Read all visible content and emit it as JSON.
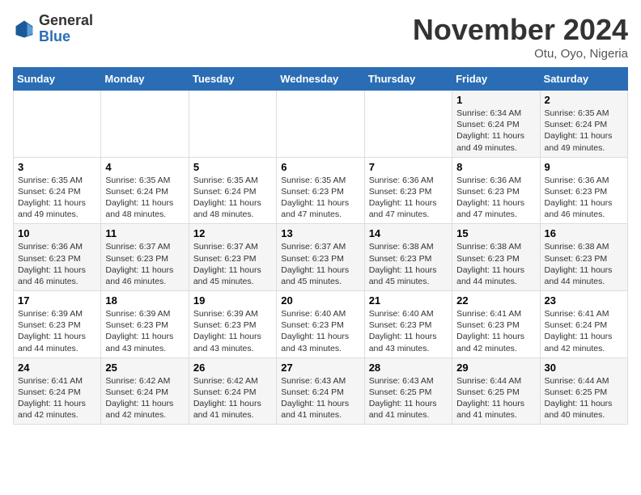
{
  "logo": {
    "general": "General",
    "blue": "Blue"
  },
  "header": {
    "month_title": "November 2024",
    "location": "Otu, Oyo, Nigeria"
  },
  "weekdays": [
    "Sunday",
    "Monday",
    "Tuesday",
    "Wednesday",
    "Thursday",
    "Friday",
    "Saturday"
  ],
  "weeks": [
    [
      {
        "day": "",
        "info": ""
      },
      {
        "day": "",
        "info": ""
      },
      {
        "day": "",
        "info": ""
      },
      {
        "day": "",
        "info": ""
      },
      {
        "day": "",
        "info": ""
      },
      {
        "day": "1",
        "info": "Sunrise: 6:34 AM\nSunset: 6:24 PM\nDaylight: 11 hours and 49 minutes."
      },
      {
        "day": "2",
        "info": "Sunrise: 6:35 AM\nSunset: 6:24 PM\nDaylight: 11 hours and 49 minutes."
      }
    ],
    [
      {
        "day": "3",
        "info": "Sunrise: 6:35 AM\nSunset: 6:24 PM\nDaylight: 11 hours and 49 minutes."
      },
      {
        "day": "4",
        "info": "Sunrise: 6:35 AM\nSunset: 6:24 PM\nDaylight: 11 hours and 48 minutes."
      },
      {
        "day": "5",
        "info": "Sunrise: 6:35 AM\nSunset: 6:24 PM\nDaylight: 11 hours and 48 minutes."
      },
      {
        "day": "6",
        "info": "Sunrise: 6:35 AM\nSunset: 6:23 PM\nDaylight: 11 hours and 47 minutes."
      },
      {
        "day": "7",
        "info": "Sunrise: 6:36 AM\nSunset: 6:23 PM\nDaylight: 11 hours and 47 minutes."
      },
      {
        "day": "8",
        "info": "Sunrise: 6:36 AM\nSunset: 6:23 PM\nDaylight: 11 hours and 47 minutes."
      },
      {
        "day": "9",
        "info": "Sunrise: 6:36 AM\nSunset: 6:23 PM\nDaylight: 11 hours and 46 minutes."
      }
    ],
    [
      {
        "day": "10",
        "info": "Sunrise: 6:36 AM\nSunset: 6:23 PM\nDaylight: 11 hours and 46 minutes."
      },
      {
        "day": "11",
        "info": "Sunrise: 6:37 AM\nSunset: 6:23 PM\nDaylight: 11 hours and 46 minutes."
      },
      {
        "day": "12",
        "info": "Sunrise: 6:37 AM\nSunset: 6:23 PM\nDaylight: 11 hours and 45 minutes."
      },
      {
        "day": "13",
        "info": "Sunrise: 6:37 AM\nSunset: 6:23 PM\nDaylight: 11 hours and 45 minutes."
      },
      {
        "day": "14",
        "info": "Sunrise: 6:38 AM\nSunset: 6:23 PM\nDaylight: 11 hours and 45 minutes."
      },
      {
        "day": "15",
        "info": "Sunrise: 6:38 AM\nSunset: 6:23 PM\nDaylight: 11 hours and 44 minutes."
      },
      {
        "day": "16",
        "info": "Sunrise: 6:38 AM\nSunset: 6:23 PM\nDaylight: 11 hours and 44 minutes."
      }
    ],
    [
      {
        "day": "17",
        "info": "Sunrise: 6:39 AM\nSunset: 6:23 PM\nDaylight: 11 hours and 44 minutes."
      },
      {
        "day": "18",
        "info": "Sunrise: 6:39 AM\nSunset: 6:23 PM\nDaylight: 11 hours and 43 minutes."
      },
      {
        "day": "19",
        "info": "Sunrise: 6:39 AM\nSunset: 6:23 PM\nDaylight: 11 hours and 43 minutes."
      },
      {
        "day": "20",
        "info": "Sunrise: 6:40 AM\nSunset: 6:23 PM\nDaylight: 11 hours and 43 minutes."
      },
      {
        "day": "21",
        "info": "Sunrise: 6:40 AM\nSunset: 6:23 PM\nDaylight: 11 hours and 43 minutes."
      },
      {
        "day": "22",
        "info": "Sunrise: 6:41 AM\nSunset: 6:23 PM\nDaylight: 11 hours and 42 minutes."
      },
      {
        "day": "23",
        "info": "Sunrise: 6:41 AM\nSunset: 6:24 PM\nDaylight: 11 hours and 42 minutes."
      }
    ],
    [
      {
        "day": "24",
        "info": "Sunrise: 6:41 AM\nSunset: 6:24 PM\nDaylight: 11 hours and 42 minutes."
      },
      {
        "day": "25",
        "info": "Sunrise: 6:42 AM\nSunset: 6:24 PM\nDaylight: 11 hours and 42 minutes."
      },
      {
        "day": "26",
        "info": "Sunrise: 6:42 AM\nSunset: 6:24 PM\nDaylight: 11 hours and 41 minutes."
      },
      {
        "day": "27",
        "info": "Sunrise: 6:43 AM\nSunset: 6:24 PM\nDaylight: 11 hours and 41 minutes."
      },
      {
        "day": "28",
        "info": "Sunrise: 6:43 AM\nSunset: 6:25 PM\nDaylight: 11 hours and 41 minutes."
      },
      {
        "day": "29",
        "info": "Sunrise: 6:44 AM\nSunset: 6:25 PM\nDaylight: 11 hours and 41 minutes."
      },
      {
        "day": "30",
        "info": "Sunrise: 6:44 AM\nSunset: 6:25 PM\nDaylight: 11 hours and 40 minutes."
      }
    ]
  ]
}
